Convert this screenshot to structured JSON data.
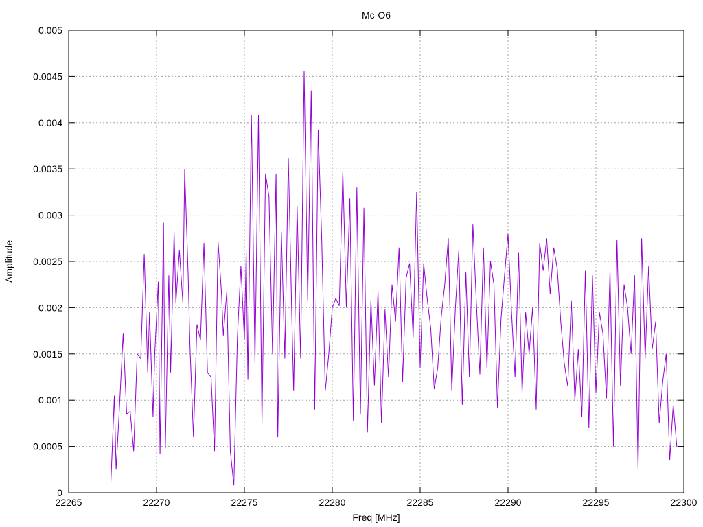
{
  "chart_data": {
    "type": "line",
    "title": "Mc-O6",
    "xlabel": "Freq [MHz]",
    "ylabel": "Amplitude",
    "xlim": [
      22265,
      22300
    ],
    "ylim": [
      0,
      0.005
    ],
    "xticks": [
      22265,
      22270,
      22275,
      22280,
      22285,
      22290,
      22295,
      22300
    ],
    "yticks": [
      0,
      0.0005,
      0.001,
      0.0015,
      0.002,
      0.0025,
      0.003,
      0.0035,
      0.004,
      0.0045,
      0.005
    ],
    "ytick_labels": [
      "0",
      "0.0005",
      "0.001",
      "0.0015",
      "0.002",
      "0.0025",
      "0.003",
      "0.0035",
      "0.004",
      "0.0045",
      "0.005"
    ],
    "grid": true,
    "line_color": "#9400d3",
    "series": [
      {
        "x": [
          22267.4,
          22267.6,
          22267.7,
          22267.9,
          22268.1,
          22268.3,
          22268.5,
          22268.7,
          22268.9,
          22269.1,
          22269.3,
          22269.5,
          22269.6,
          22269.8,
          22269.9,
          22270.1,
          22270.2,
          22270.4,
          22270.5,
          22270.7,
          22270.8,
          22271.0,
          22271.1,
          22271.3,
          22271.5,
          22271.6,
          22271.8,
          22271.9,
          22272.1,
          22272.3,
          22272.5,
          22272.7,
          22272.9,
          22273.1,
          22273.3,
          22273.5,
          22273.7,
          22273.8,
          22274.0,
          22274.2,
          22274.4,
          22274.6,
          22274.8,
          22275.0,
          22275.1,
          22275.2,
          22275.4,
          22275.6,
          22275.8,
          22276.0,
          22276.2,
          22276.4,
          22276.6,
          22276.8,
          22276.9,
          22277.1,
          22277.3,
          22277.5,
          22277.7,
          22277.8,
          22278.0,
          22278.2,
          22278.4,
          22278.6,
          22278.8,
          22279.0,
          22279.2,
          22279.4,
          22279.6,
          22279.8,
          22280.0,
          22280.2,
          22280.4,
          22280.6,
          22280.8,
          22281.0,
          22281.2,
          22281.4,
          22281.6,
          22281.8,
          22282.0,
          22282.2,
          22282.4,
          22282.6,
          22282.8,
          22283.0,
          22283.2,
          22283.4,
          22283.6,
          22283.8,
          22284.0,
          22284.2,
          22284.4,
          22284.6,
          22284.8,
          22285.0,
          22285.2,
          22285.4,
          22285.6,
          22285.8,
          22286.0,
          22286.2,
          22286.4,
          22286.6,
          22286.8,
          22287.0,
          22287.2,
          22287.4,
          22287.6,
          22287.8,
          22288.0,
          22288.2,
          22288.4,
          22288.6,
          22288.8,
          22289.0,
          22289.2,
          22289.4,
          22289.6,
          22289.8,
          22290.0,
          22290.2,
          22290.4,
          22290.6,
          22290.8,
          22291.0,
          22291.2,
          22291.4,
          22291.6,
          22291.8,
          22292.0,
          22292.2,
          22292.4,
          22292.6,
          22292.8,
          22293.0,
          22293.2,
          22293.4,
          22293.6,
          22293.8,
          22294.0,
          22294.2,
          22294.4,
          22294.6,
          22294.8,
          22295.0,
          22295.2,
          22295.4,
          22295.6,
          22295.8,
          22296.0,
          22296.2,
          22296.4,
          22296.6,
          22296.8,
          22297.0,
          22297.2,
          22297.4,
          22297.6,
          22297.8,
          22298.0,
          22298.2,
          22298.4,
          22298.6,
          22298.8,
          22299.0,
          22299.2,
          22299.4,
          22299.6
        ],
        "y": [
          9e-05,
          0.00105,
          0.00025,
          0.00095,
          0.00172,
          0.00085,
          0.00088,
          0.00045,
          0.0015,
          0.00145,
          0.00258,
          0.0013,
          0.00195,
          0.00082,
          0.0015,
          0.00228,
          0.00042,
          0.00292,
          0.00048,
          0.00235,
          0.0013,
          0.00282,
          0.00205,
          0.00262,
          0.00205,
          0.0035,
          0.00235,
          0.0016,
          0.0006,
          0.00182,
          0.00165,
          0.0027,
          0.0013,
          0.00125,
          0.00045,
          0.00272,
          0.00215,
          0.0017,
          0.00218,
          0.00045,
          8e-05,
          0.00168,
          0.00245,
          0.00165,
          0.00262,
          0.00122,
          0.00408,
          0.0014,
          0.00408,
          0.00075,
          0.00345,
          0.0032,
          0.0015,
          0.00345,
          0.0006,
          0.00282,
          0.00145,
          0.00362,
          0.0019,
          0.0011,
          0.0031,
          0.00145,
          0.00456,
          0.00208,
          0.00435,
          0.0009,
          0.00392,
          0.00275,
          0.0011,
          0.0015,
          0.002,
          0.0021,
          0.00202,
          0.00348,
          0.002,
          0.00318,
          0.00078,
          0.0033,
          0.00085,
          0.00308,
          0.00065,
          0.00208,
          0.00116,
          0.00218,
          0.00075,
          0.00198,
          0.00125,
          0.00225,
          0.00185,
          0.00265,
          0.0012,
          0.00232,
          0.00248,
          0.00168,
          0.00325,
          0.00135,
          0.00248,
          0.0021,
          0.00178,
          0.00112,
          0.00135,
          0.0019,
          0.00225,
          0.00275,
          0.0011,
          0.00198,
          0.00262,
          0.00095,
          0.00238,
          0.00125,
          0.0029,
          0.00205,
          0.00128,
          0.00265,
          0.00135,
          0.0025,
          0.00225,
          0.00092,
          0.00188,
          0.00235,
          0.0028,
          0.00195,
          0.00125,
          0.0026,
          0.00108,
          0.00195,
          0.0015,
          0.002,
          0.0009,
          0.0027,
          0.0024,
          0.00275,
          0.00215,
          0.00265,
          0.00242,
          0.00185,
          0.0014,
          0.00115,
          0.00208,
          0.001,
          0.00155,
          0.00082,
          0.0024,
          0.0007,
          0.00235,
          0.00108,
          0.00195,
          0.00172,
          0.00102,
          0.0024,
          0.0005,
          0.00273,
          0.00115,
          0.00225,
          0.002,
          0.0015,
          0.00235,
          0.00025,
          0.00275,
          0.00145,
          0.00245,
          0.00155,
          0.00185,
          0.00075,
          0.0012,
          0.0015,
          0.00035,
          0.00095,
          0.0005
        ]
      }
    ]
  }
}
